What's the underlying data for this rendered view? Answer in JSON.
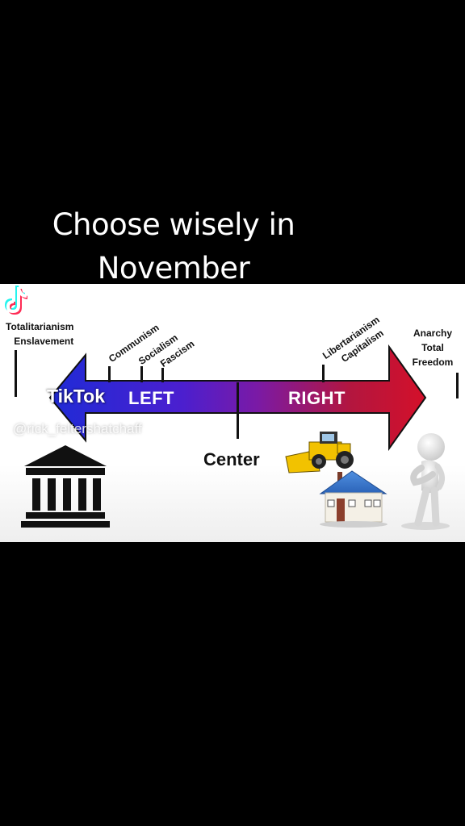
{
  "caption": {
    "line1": "Choose wisely in",
    "line2": "November"
  },
  "diagram": {
    "left_end": {
      "line1": "Totalitarianism",
      "line2": "Enslavement"
    },
    "right_end": {
      "line1": "Anarchy",
      "line2": "Total",
      "line3": "Freedom"
    },
    "left_labels": [
      "Communism",
      "Socialism",
      "Fascism"
    ],
    "right_labels": [
      "Libertarianism",
      "Capitalism"
    ],
    "arrow_left_label": "LEFT",
    "arrow_right_label": "RIGHT",
    "center_label": "Center",
    "colors": {
      "left": "#1f2bd6",
      "middle": "#7a1aa6",
      "right": "#d4102a"
    },
    "icons": [
      "government-building-icon",
      "bulldozer-icon",
      "house-icon",
      "thinking-figure-icon"
    ]
  },
  "watermark": {
    "brand": "TikTok",
    "handle": "@rick_feltershatchaff"
  }
}
